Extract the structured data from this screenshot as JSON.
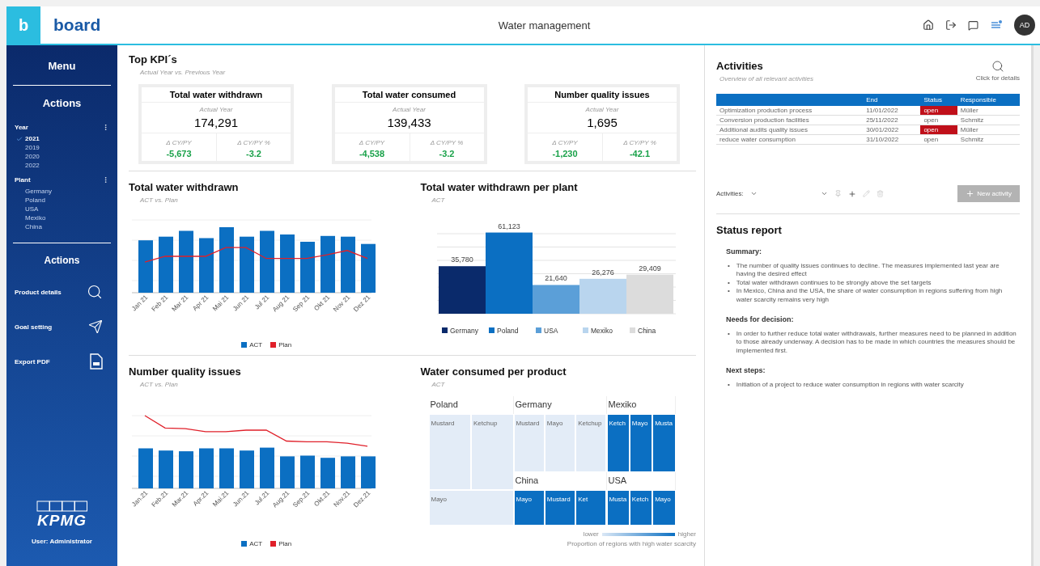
{
  "header": {
    "logo_mark": "b",
    "logo_text": "board",
    "title": "Water management",
    "avatar": "AD"
  },
  "sidebar": {
    "menu": "Menu",
    "actions_title": "Actions",
    "year": {
      "label": "Year",
      "items": [
        {
          "label": "2021",
          "selected": true
        },
        {
          "label": "2019",
          "selected": false
        },
        {
          "label": "2020",
          "selected": false
        },
        {
          "label": "2022",
          "selected": false
        }
      ]
    },
    "plant": {
      "label": "Plant",
      "items": [
        {
          "label": "Germany",
          "selected": false
        },
        {
          "label": "Poland",
          "selected": false
        },
        {
          "label": "USA",
          "selected": false
        },
        {
          "label": "Mexiko",
          "selected": false
        },
        {
          "label": "China",
          "selected": false
        }
      ]
    },
    "actions2_title": "Actions",
    "actions": [
      {
        "label": "Product details",
        "kind": "search"
      },
      {
        "label": "Goal setting",
        "kind": "send"
      },
      {
        "label": "Export PDF",
        "kind": "pdf"
      }
    ],
    "brand": "KPMG",
    "user": "User: Administrator"
  },
  "kpi": {
    "title": "Top KPI´s",
    "subtitle": "Actual Year vs. Previous Year",
    "cards": [
      {
        "title": "Total water withdrawn",
        "period": "Actual Year",
        "value": "174,291",
        "delta_label": "Δ CY/PY",
        "delta": "-5,673",
        "pct_label": "Δ CY/PY %",
        "pct": "-3.2"
      },
      {
        "title": "Total water consumed",
        "period": "Actual Year",
        "value": "139,433",
        "delta_label": "Δ CY/PY",
        "delta": "-4,538",
        "pct_label": "Δ CY/PY %",
        "pct": "-3.2"
      },
      {
        "title": "Number quality issues",
        "period": "Actual Year",
        "value": "1,695",
        "delta_label": "Δ CY/PY",
        "delta": "-1,230",
        "pct_label": "Δ CY/PY %",
        "pct": "-42.1"
      }
    ]
  },
  "withdrawn_chart": {
    "title": "Total water withdrawn",
    "subtitle": "ACT vs. Plan",
    "x_labels": [
      "Jan 21",
      "Feb 21",
      "Mar 21",
      "Apr 21",
      "Mai 21",
      "Jun 21",
      "Jul 21",
      "Aug 21",
      "Sep 21",
      "Okt 21",
      "Nov 21",
      "Dez 21"
    ],
    "legend": [
      {
        "label": "ACT",
        "color": "#0b6fc2"
      },
      {
        "label": "Plan",
        "color": "#e0202a"
      }
    ]
  },
  "plant_chart": {
    "title": "Total water withdrawn per plant",
    "subtitle": "ACT",
    "chart_data": {
      "type": "bar",
      "categories": [
        "Germany",
        "Poland",
        "USA",
        "Mexiko",
        "China"
      ],
      "values": [
        35780,
        61123,
        21640,
        26276,
        29409
      ],
      "value_labels": [
        "35,780",
        "61,123",
        "21,640",
        "26,276",
        "29,409"
      ]
    },
    "bars": [
      {
        "color": "#0a2a6b"
      },
      {
        "color": "#0b6fc2"
      },
      {
        "color": "#5b9fd8"
      },
      {
        "color": "#b9d5ee"
      },
      {
        "color": "#dcdcdc"
      }
    ]
  },
  "quality_chart": {
    "title": "Number quality issues",
    "subtitle": "ACT vs. Plan",
    "x_labels": [
      "Jan.21",
      "Feb.21",
      "Mar.21",
      "Apr.21",
      "Mai.21",
      "Jun.21",
      "Jul.21",
      "Aug.21",
      "Sep.21",
      "Okt.21",
      "Nov.21",
      "Dez.21"
    ],
    "legend": [
      {
        "label": "ACT",
        "color": "#0b6fc2"
      },
      {
        "label": "Plan",
        "color": "#e0202a"
      }
    ]
  },
  "treemap": {
    "title": "Water consumed per product",
    "subtitle": "ACT",
    "groups": [
      {
        "label": "Poland",
        "cells": [
          {
            "label": "Mustard",
            "color": "#e3ecf7"
          },
          {
            "label": "Ketchup",
            "color": "#e3ecf7"
          },
          {
            "label": "Mayo",
            "color": "#e3ecf7"
          }
        ]
      },
      {
        "label": "Germany",
        "cells": [
          {
            "label": "Mustard",
            "color": "#e3ecf7"
          },
          {
            "label": "Mayo",
            "color": "#e3ecf7"
          },
          {
            "label": "Ketchup",
            "color": "#e3ecf7"
          }
        ]
      },
      {
        "label": "Mexiko",
        "cells": [
          {
            "label": "Ketch",
            "color": "#0b6fc2"
          },
          {
            "label": "Mayo",
            "color": "#0b6fc2"
          },
          {
            "label": "Musta",
            "color": "#0b6fc2"
          }
        ]
      },
      {
        "label": "China",
        "cells": [
          {
            "label": "Mayo",
            "color": "#0b6fc2"
          },
          {
            "label": "Mustard",
            "color": "#0b6fc2"
          },
          {
            "label": "Ket",
            "color": "#0b6fc2"
          }
        ]
      },
      {
        "label": "USA",
        "cells": [
          {
            "label": "Musta",
            "color": "#0b6fc2"
          },
          {
            "label": "Ketch",
            "color": "#0b6fc2"
          },
          {
            "label": "Mayo",
            "color": "#0b6fc2"
          }
        ]
      }
    ],
    "scale_low": "lower",
    "scale_high": "higher",
    "caption": "Proportion of regions with high water scarcity"
  },
  "activities": {
    "title": "Activities",
    "subtitle": "Overview of all relevant activities",
    "details": "Click for details",
    "columns": [
      "End",
      "Status",
      "Responsible"
    ],
    "rows": [
      {
        "name": "Optimization production process",
        "end": "11/01/2022",
        "status": "open",
        "alert": true,
        "responsible": "Müller"
      },
      {
        "name": "Conversion production facilities",
        "end": "25/11/2022",
        "status": "open",
        "alert": false,
        "responsible": "Schmitz"
      },
      {
        "name": "Additional audits quality issues",
        "end": "30/01/2022",
        "status": "open",
        "alert": true,
        "responsible": "Müller"
      },
      {
        "name": "reduce water consumption",
        "end": "31/10/2022",
        "status": "open",
        "alert": false,
        "responsible": "Schmitz"
      }
    ],
    "filter_label": "Activities:",
    "new_button": {
      "label": "New activity",
      "disabled": true
    }
  },
  "status_report": {
    "title": "Status report",
    "bullet": "•",
    "sections": [
      {
        "heading": "Summary:",
        "items": [
          "The number of quality issues continues to decline. The measures implemented last year are having the desired effect",
          "Total water withdrawn continues to be strongly above the set targets",
          "In Mexico, China and the USA, the share of water consumption in regions suffering from high water scarcity remains very high"
        ]
      },
      {
        "heading": "Needs for decision:",
        "items": [
          "In order to further reduce total water withdrawals, further measures need to be planned in addition to those already underway. A decision has to be made in which countries the measures should be implemented first."
        ]
      },
      {
        "heading": "Next steps:",
        "items": [
          "Initiation of a project to reduce water consumption in regions with water scarcity"
        ]
      }
    ]
  }
}
